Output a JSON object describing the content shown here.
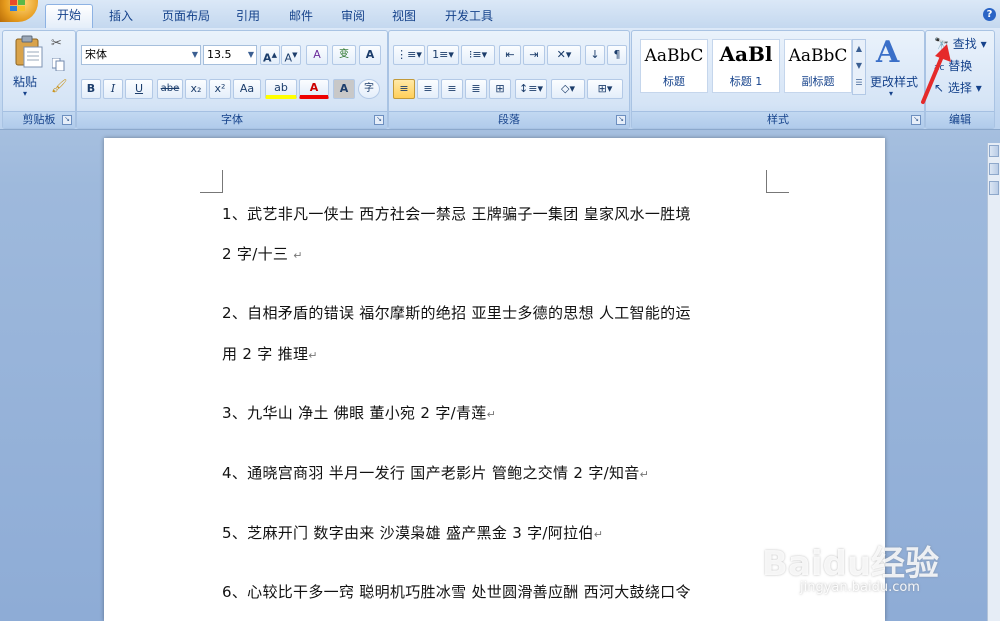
{
  "tabs": [
    "开始",
    "插入",
    "页面布局",
    "引用",
    "邮件",
    "审阅",
    "视图",
    "开发工具"
  ],
  "active_tab": 0,
  "ribbon": {
    "clipboard": {
      "label": "剪贴板",
      "paste_label": "粘贴"
    },
    "font": {
      "label": "字体",
      "font_name": "宋体",
      "font_size": "13.5",
      "phonetic_btn": "变",
      "bold": "B",
      "italic": "I",
      "underline": "U",
      "strike": "abe",
      "sub": "x₂",
      "sup": "x²",
      "case": "Aa",
      "highlight": "ab",
      "font_color": "A",
      "char_shade": "A",
      "enclose": "字",
      "grow": "A",
      "shrink": "A",
      "clear": "A",
      "border_char": "A"
    },
    "paragraph": {
      "label": "段落"
    },
    "styles": {
      "label": "样式",
      "items": [
        {
          "sample": "AaBbC",
          "name": "标题"
        },
        {
          "sample": "AaBl",
          "name": "标题 1"
        },
        {
          "sample": "AaBbC",
          "name": "副标题"
        }
      ],
      "change_styles": "更改样式"
    },
    "editing": {
      "label": "编辑",
      "find": "查找",
      "replace": "替换",
      "select": "选择"
    }
  },
  "document": {
    "paragraphs": [
      {
        "line1": "1、武艺非凡一侠士 西方社会一禁忌 王牌骗子一集团 皇家风水一胜境",
        "line2": " 2 字/十三 "
      },
      {
        "line1": "2、自相矛盾的错误 福尔摩斯的绝招 亚里士多德的思想 人工智能的运",
        "line2": "用 2 字 推理"
      },
      {
        "line1": "3、九华山 净土 佛眼 董小宛 2 字/青莲"
      },
      {
        "line1": "4、通晓宫商羽 半月一发行 国产老影片 管鲍之交情 2 字/知音"
      },
      {
        "line1": "5、芝麻开门 数字由来 沙漠枭雄 盛产黑金 3 字/阿拉伯"
      },
      {
        "line1": "6、心较比干多一窍 聪明机巧胜冰雪 处世圆滑善应酬 西河大鼓绕口令"
      }
    ],
    "para_mark": "↵"
  },
  "watermark": {
    "brand": "Baidu经验",
    "url": "jingyan.baidu.com"
  }
}
